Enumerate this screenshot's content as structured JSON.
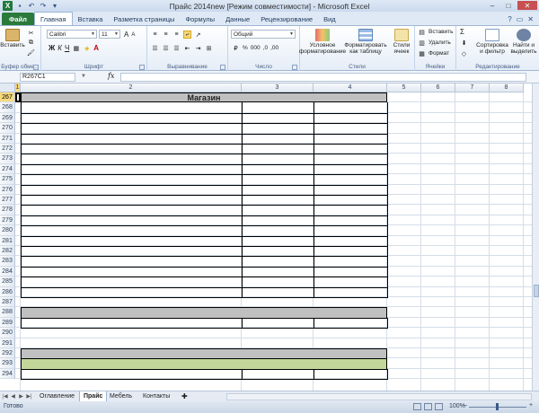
{
  "window": {
    "title": "Прайс 2014new  [Режим совместимости] - Microsoft Excel",
    "min": "–",
    "max": "□",
    "close": "✕"
  },
  "tabs": [
    {
      "label": "Файл"
    },
    {
      "label": "Главная"
    },
    {
      "label": "Вставка"
    },
    {
      "label": "Разметка страницы"
    },
    {
      "label": "Формулы"
    },
    {
      "label": "Данные"
    },
    {
      "label": "Рецензирование"
    },
    {
      "label": "Вид"
    }
  ],
  "ribbon": {
    "clipboard": {
      "paste": "Вставить",
      "label": "Буфер обме..."
    },
    "font": {
      "name": "Calibri",
      "size": "11",
      "label": "Шрифт",
      "bold": "Ж",
      "italic": "К",
      "underline": "Ч",
      "grow": "A",
      "shrink": "A",
      "color_letter": "A"
    },
    "alignment": {
      "label": "Выравнивание"
    },
    "number": {
      "format": "Общий",
      "label": "Число",
      "percent": "%",
      "thousands": "000",
      "dec_inc": ",0",
      "dec_dec": ",00"
    },
    "styles": {
      "conditional": "Условное форматирование",
      "as_table": "Форматировать как таблицу",
      "cell_styles": "Стили ячеек",
      "label": "Стили"
    },
    "cells": {
      "insert": "Вставить",
      "delete": "Удалить",
      "format": "Формат",
      "label": "Ячейки"
    },
    "editing": {
      "sum": "Σ",
      "sort": "Сортировка и фильтр",
      "find": "Найти и выделить",
      "label": "Редактирование"
    }
  },
  "formula_bar": {
    "namebox": "R267C1",
    "fx": "fx",
    "value": ""
  },
  "columns": [
    "1",
    "2",
    "3",
    "4",
    "5",
    "6",
    "7",
    "8"
  ],
  "rows": [
    "267",
    "268",
    "269",
    "270",
    "271",
    "272",
    "273",
    "274",
    "275",
    "276",
    "277",
    "278",
    "279",
    "280",
    "281",
    "282",
    "283",
    "284",
    "285",
    "286",
    "287",
    "288",
    "289",
    "290",
    "291",
    "292",
    "293",
    "294"
  ],
  "cells": {
    "shop_title": "Магазин"
  },
  "sheets": [
    {
      "label": "Оглавление"
    },
    {
      "label": "Прайс"
    },
    {
      "label": "Мебель"
    },
    {
      "label": "Контакты"
    }
  ],
  "status": {
    "ready": "Готово",
    "zoom": "100%",
    "zoom_minus": "–",
    "zoom_plus": "+"
  },
  "colors": {
    "header_fill": "#c0c0c0",
    "green_fill": "#c4d79b",
    "selection": "#f8d97d",
    "file_tab": "#2a7a3c"
  }
}
